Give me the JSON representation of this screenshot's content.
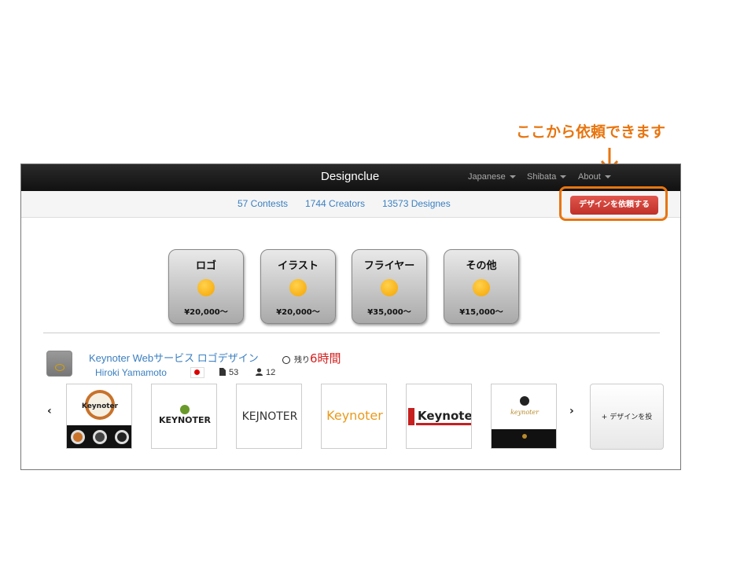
{
  "annotation": {
    "callout_text": "ここから依頼できます",
    "accent_color": "#e8750f"
  },
  "navbar": {
    "brand": "Designclue",
    "menus": [
      "Japanese",
      "Shibata",
      "About"
    ]
  },
  "stats": {
    "contests": "57 Contests",
    "creators": "1744 Creators",
    "designs": "13573 Designes"
  },
  "cta": {
    "label": "デザインを依頼する",
    "color": "#c9342c"
  },
  "categories": [
    {
      "title": "ロゴ",
      "price": "¥20,000〜"
    },
    {
      "title": "イラスト",
      "price": "¥20,000〜"
    },
    {
      "title": "フライヤー",
      "price": "¥35,000〜"
    },
    {
      "title": "その他",
      "price": "¥15,000〜"
    }
  ],
  "contest": {
    "title": "Keynoter Webサービス ロゴデザイン",
    "remaining_label": "残り",
    "remaining_value": "6時間",
    "author": "Hiroki Yamamoto",
    "designs_count": "53",
    "participants_count": "12",
    "thumbnails": [
      {
        "text": "Keynoter",
        "icon": "badge-logo"
      },
      {
        "text": "KEYNOTER",
        "icon": "tree-logo"
      },
      {
        "text": "KEJNOTER",
        "icon": "none"
      },
      {
        "text": "Keynoter",
        "icon": "none"
      },
      {
        "text": "Keynote",
        "icon": "red-bar-logo"
      },
      {
        "text": "keynoter",
        "icon": "star-logo"
      }
    ],
    "prev_label": "‹",
    "next_label": "›",
    "add_label": "+ デザインを投"
  }
}
